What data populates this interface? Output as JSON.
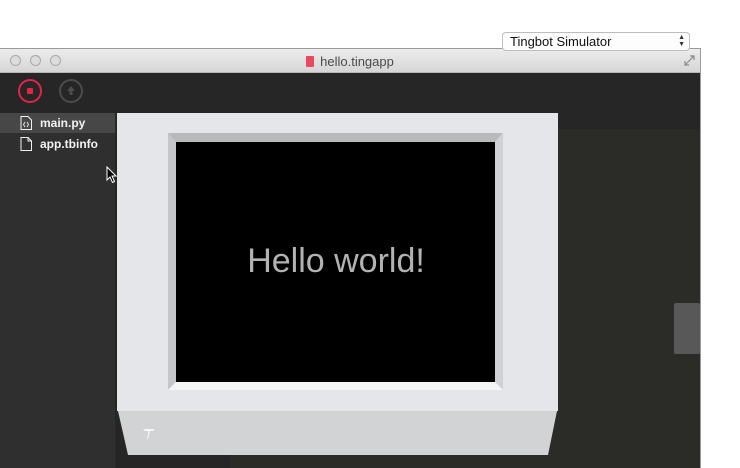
{
  "window": {
    "title": "hello.tingapp"
  },
  "toolbar": {
    "stop_icon": "stop-icon",
    "upload_icon": "upload-icon",
    "device_select": {
      "selected": "Tingbot Simulator"
    }
  },
  "sidebar": {
    "files": [
      {
        "label": "main.py",
        "icon": "code-file-icon",
        "active": true
      },
      {
        "label": "app.tbinfo",
        "icon": "file-icon",
        "active": false
      }
    ]
  },
  "simulator": {
    "screen_text": "Hello world!",
    "logo_icon": "tingbot-logo-icon"
  },
  "colors": {
    "accent": "#e2234a",
    "device_body": "#e4e6e9",
    "screen": "#000000"
  }
}
